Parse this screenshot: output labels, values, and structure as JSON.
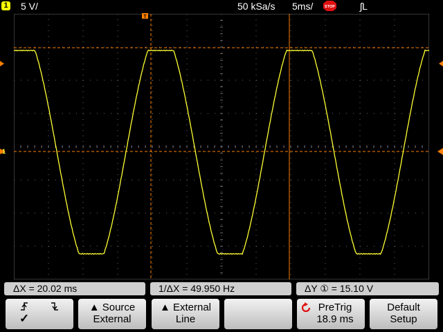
{
  "topbar": {
    "channel_number": "1",
    "volts_per_div": "5 V/",
    "sample_rate": "50 kSa/s",
    "time_per_div": "5ms/",
    "run_state": "STOP",
    "trigger": "ʃL"
  },
  "measurements": {
    "delta_x": "ΔX = 20.02 ms",
    "inv_delta_x": "1/ΔX = 49.950  Hz",
    "delta_y": "ΔY ① = 15.10  V"
  },
  "softkeys": {
    "mode_check": "✓",
    "source_l1": "▲ Source",
    "source_l2": "External",
    "external_l1": "▲ External",
    "external_l2": "Line",
    "pretrig_l1": "PreTrig",
    "pretrig_l2": "18.9 ms",
    "default_l1": "Default",
    "default_l2": "Setup"
  },
  "colors": {
    "trace": "#ffff33",
    "cursor": "#ff7f00",
    "grid": "#6a6a6a",
    "background": "#000000",
    "softkey": "#d9d9d9"
  },
  "waveform": {
    "type": "sine",
    "frequency_hz": 49.95,
    "period_ms": 20.02,
    "volts_per_div": 5,
    "time_per_div_ms": 5,
    "peak_to_peak_v": 15.1,
    "clipped": "flat top and bottom"
  }
}
